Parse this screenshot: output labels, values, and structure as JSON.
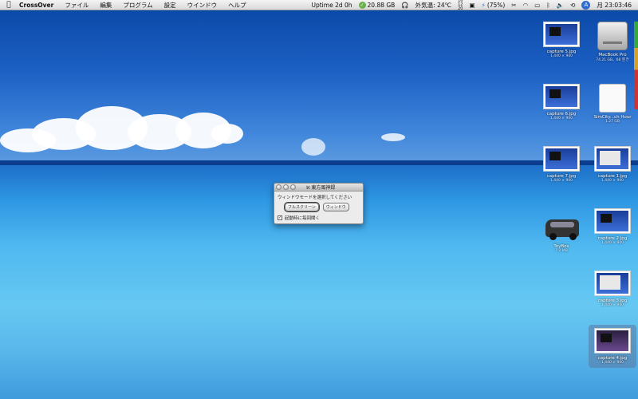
{
  "menubar": {
    "app_name": "CrossOver",
    "items": [
      "ファイル",
      "編集",
      "プログラム",
      "設定",
      "ウインドウ",
      "ヘルプ"
    ],
    "status": {
      "uptime": "Uptime 2d 0h",
      "disk": "20.88 GB",
      "temperature": "外気温: 24℃",
      "cal_top": "16",
      "cal_mid": "12",
      "cal_bottom": "20",
      "battery": "(75%)",
      "clock": "月 23:03:46"
    }
  },
  "dialog": {
    "title": "東方風神録",
    "message": "ウィンドウモードを選択してください",
    "fullscreen_label": "フルスクリーン",
    "window_label": "ウィンドウ",
    "checkbox_label": "起動時に毎回聞く",
    "checkbox_checked": true
  },
  "desktop": {
    "icons": [
      {
        "name": "capture 5.jpg",
        "sub": "1,440 × 900"
      },
      {
        "name": "MacBook Pro",
        "sub": "74.21 GB、68 空き"
      },
      {
        "name": "capture 6.jpg",
        "sub": "1,440 × 900"
      },
      {
        "name": "SimCity...ch Hour",
        "sub": "1.27 GB"
      },
      {
        "name": "capture 7.jpg",
        "sub": "1,440 × 900"
      },
      {
        "name": "capture 1.jpg",
        "sub": "1,440 × 900"
      },
      {
        "name": "ToyBox",
        "sub": "7.2 MB"
      },
      {
        "name": "capture 2.jpg",
        "sub": "1,440 × 900"
      },
      {
        "name": "capture 3.jpg",
        "sub": "1,440 × 900"
      },
      {
        "name": "capture 4.jpg",
        "sub": "1,440 × 900"
      }
    ]
  }
}
